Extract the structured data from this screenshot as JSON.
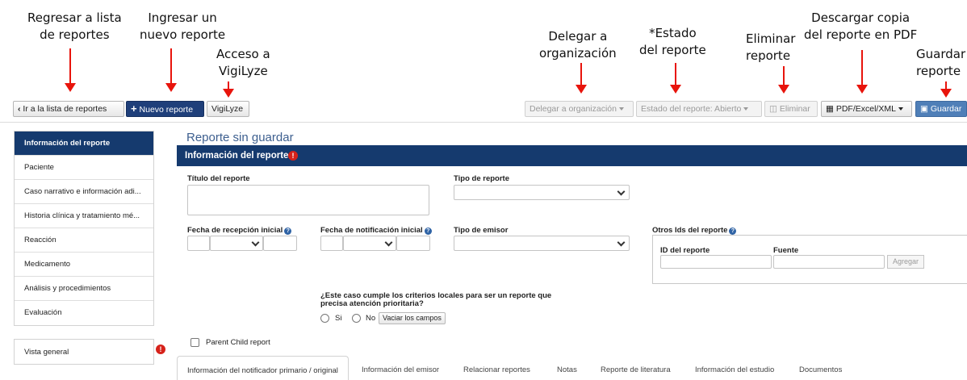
{
  "annotations": {
    "back": [
      "Regresar a lista",
      "de reportes"
    ],
    "new": [
      "Ingresar un",
      "nuevo reporte"
    ],
    "vigilyze": [
      "Acceso a",
      "VigiLyze"
    ],
    "delegate": [
      "Delegar a",
      "organización"
    ],
    "status": [
      "*Estado",
      "del reporte"
    ],
    "delete": [
      "Eliminar",
      "reporte"
    ],
    "download": [
      "Descargar copia",
      "del reporte en PDF"
    ],
    "save": [
      "Guardar",
      "reporte"
    ]
  },
  "toolbar": {
    "back_label": "Ir a la lista de reportes",
    "new_label": "Nuevo reporte",
    "vigilyze_label": "VigiLyze",
    "delegate_label": "Delegar a organización",
    "status_label": "Estado del reporte: Abierto",
    "delete_label": "Eliminar",
    "export_label": "PDF/Excel/XML",
    "save_label": "Guardar"
  },
  "sidebar": {
    "items": [
      {
        "label": "Información del reporte",
        "active": true
      },
      {
        "label": "Paciente"
      },
      {
        "label": "Caso narrativo e información adi..."
      },
      {
        "label": "Historia clínica y tratamiento mé..."
      },
      {
        "label": "Reacción"
      },
      {
        "label": "Medicamento"
      },
      {
        "label": "Análisis y procedimientos"
      },
      {
        "label": "Evaluación"
      }
    ],
    "overview_label": "Vista general"
  },
  "main": {
    "title": "Reporte sin guardar",
    "section_title": "Información del reporte",
    "fields": {
      "report_title_label": "Título del reporte",
      "report_type_label": "Tipo de reporte",
      "initial_receipt_label": "Fecha de recepción inicial",
      "initial_notification_label": "Fecha de notificación inicial",
      "sender_type_label": "Tipo de emisor",
      "other_ids_label": "Otros Ids del reporte",
      "report_id_label": "ID del reporte",
      "source_label": "Fuente",
      "add_label": "Agregar"
    },
    "priority": {
      "question": "¿Este caso cumple los criterios locales para ser un reporte que precisa atención prioritaria?",
      "yes_label": "Si",
      "no_label": "No",
      "clear_label": "Vaciar los campos"
    },
    "parent_child_label": "Parent Child report",
    "tabs": [
      "Información del notificador primario / original",
      "Información del emisor",
      "Relacionar reportes",
      "Notas",
      "Reporte de literatura",
      "Información del estudio",
      "Documentos"
    ]
  },
  "colors": {
    "navy": "#153a6e",
    "arrow_red": "#e8140c",
    "alert_red": "#d6221a",
    "save_blue": "#4f7fb8"
  }
}
